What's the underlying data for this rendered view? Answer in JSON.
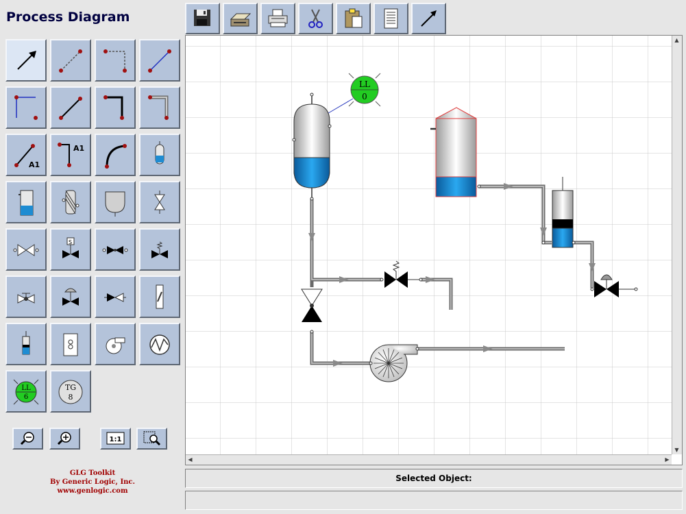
{
  "app": {
    "title": "Process Diagram"
  },
  "toolbar": {
    "buttons": [
      "save-icon",
      "scanner-icon",
      "print-icon",
      "cut-icon",
      "paste-icon",
      "list-icon",
      "select-arrow-icon"
    ]
  },
  "palette": {
    "labels": {
      "a1": "A1",
      "a1b": "A1",
      "ll_level": "LL",
      "ll_value": "6",
      "tg_label": "TG",
      "tg_value": "8"
    }
  },
  "zoom": {
    "one_to_one": "1:1"
  },
  "credits": {
    "line1": "GLG Toolkit",
    "line2": "By Generic Logic, Inc.",
    "line3": "www.genlogic.com"
  },
  "diagram": {
    "indicator_label": "LL",
    "indicator_value": "0",
    "colors": {
      "fluid": "#1e8cd2",
      "indicator": "#22cc22",
      "silo_outline": "#e04040",
      "pipe": "#808080"
    }
  },
  "status": {
    "selected_label": "Selected Object:",
    "secondary": ""
  }
}
